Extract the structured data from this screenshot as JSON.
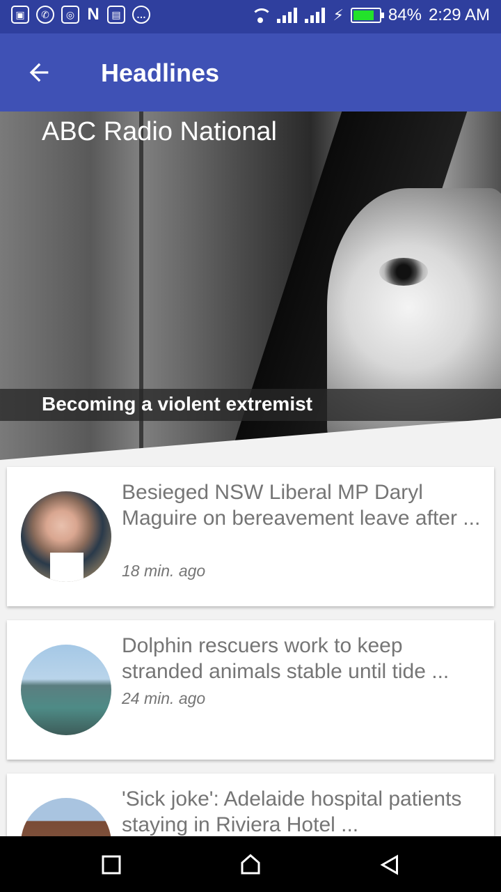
{
  "status_bar": {
    "battery_percent": "84%",
    "battery_level": 0.84,
    "time": "2:29 AM",
    "left_icons": [
      "gallery-icon",
      "whatsapp-icon",
      "instagram-icon",
      "n-icon",
      "calendar-icon",
      "chat-icon"
    ],
    "right_icons": [
      "wifi-icon",
      "signal-icon",
      "signal-icon",
      "charging-icon",
      "battery-icon"
    ]
  },
  "app_bar": {
    "title": "Headlines",
    "back_icon": "arrow-left-icon"
  },
  "hero": {
    "source": "ABC Radio National",
    "caption": "Becoming a violent extremist"
  },
  "articles": [
    {
      "title": "Besieged NSW Liberal MP Daryl Maguire on bereavement leave after ...",
      "time": "18 min. ago"
    },
    {
      "title": "Dolphin rescuers work to keep stranded animals stable until tide ...",
      "time": "24 min. ago"
    },
    {
      "title": "'Sick joke': Adelaide hospital patients staying in Riviera Hotel ...",
      "time": ""
    }
  ],
  "nav_bar": {
    "icons": [
      "recent-apps-icon",
      "home-icon",
      "back-icon"
    ]
  },
  "colors": {
    "status_bar": "#2f3f9e",
    "app_bar": "#3f51b5",
    "battery": "#23e22b",
    "text_secondary": "#757575"
  }
}
